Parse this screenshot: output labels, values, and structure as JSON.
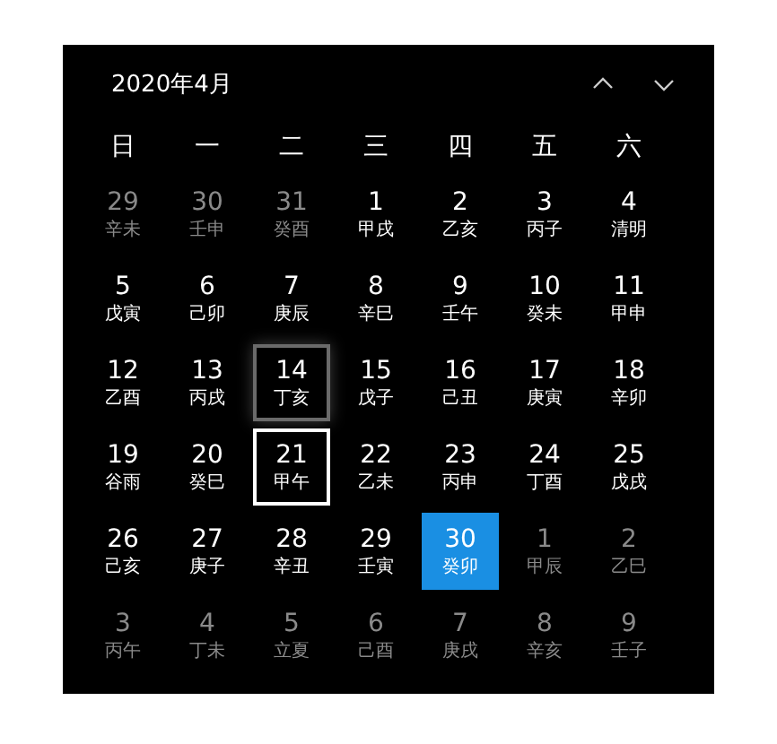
{
  "calendar": {
    "title": "2020年4月",
    "nav": [
      {
        "kind": "previous"
      },
      {
        "kind": "next"
      }
    ],
    "weekdays": [
      "日",
      "一",
      "二",
      "三",
      "四",
      "五",
      "六"
    ],
    "days": [
      {
        "day": "29",
        "lunar": "辛未",
        "in_month": false,
        "today": false,
        "selected": false,
        "hovered": false
      },
      {
        "day": "30",
        "lunar": "壬申",
        "in_month": false,
        "today": false,
        "selected": false,
        "hovered": false
      },
      {
        "day": "31",
        "lunar": "癸酉",
        "in_month": false,
        "today": false,
        "selected": false,
        "hovered": false
      },
      {
        "day": "1",
        "lunar": "甲戌",
        "in_month": true,
        "today": false,
        "selected": false,
        "hovered": false
      },
      {
        "day": "2",
        "lunar": "乙亥",
        "in_month": true,
        "today": false,
        "selected": false,
        "hovered": false
      },
      {
        "day": "3",
        "lunar": "丙子",
        "in_month": true,
        "today": false,
        "selected": false,
        "hovered": false
      },
      {
        "day": "4",
        "lunar": "清明",
        "in_month": true,
        "today": false,
        "selected": false,
        "hovered": false
      },
      {
        "day": "5",
        "lunar": "戊寅",
        "in_month": true,
        "today": false,
        "selected": false,
        "hovered": false
      },
      {
        "day": "6",
        "lunar": "己卯",
        "in_month": true,
        "today": false,
        "selected": false,
        "hovered": false
      },
      {
        "day": "7",
        "lunar": "庚辰",
        "in_month": true,
        "today": false,
        "selected": false,
        "hovered": false
      },
      {
        "day": "8",
        "lunar": "辛巳",
        "in_month": true,
        "today": false,
        "selected": false,
        "hovered": false
      },
      {
        "day": "9",
        "lunar": "壬午",
        "in_month": true,
        "today": false,
        "selected": false,
        "hovered": false
      },
      {
        "day": "10",
        "lunar": "癸未",
        "in_month": true,
        "today": false,
        "selected": false,
        "hovered": false
      },
      {
        "day": "11",
        "lunar": "甲申",
        "in_month": true,
        "today": false,
        "selected": false,
        "hovered": false
      },
      {
        "day": "12",
        "lunar": "乙酉",
        "in_month": true,
        "today": false,
        "selected": false,
        "hovered": false
      },
      {
        "day": "13",
        "lunar": "丙戌",
        "in_month": true,
        "today": false,
        "selected": false,
        "hovered": false
      },
      {
        "day": "14",
        "lunar": "丁亥",
        "in_month": true,
        "today": false,
        "selected": false,
        "hovered": true
      },
      {
        "day": "15",
        "lunar": "戊子",
        "in_month": true,
        "today": false,
        "selected": false,
        "hovered": false
      },
      {
        "day": "16",
        "lunar": "己丑",
        "in_month": true,
        "today": false,
        "selected": false,
        "hovered": false
      },
      {
        "day": "17",
        "lunar": "庚寅",
        "in_month": true,
        "today": false,
        "selected": false,
        "hovered": false
      },
      {
        "day": "18",
        "lunar": "辛卯",
        "in_month": true,
        "today": false,
        "selected": false,
        "hovered": false
      },
      {
        "day": "19",
        "lunar": "谷雨",
        "in_month": true,
        "today": false,
        "selected": false,
        "hovered": false
      },
      {
        "day": "20",
        "lunar": "癸巳",
        "in_month": true,
        "today": false,
        "selected": false,
        "hovered": false
      },
      {
        "day": "21",
        "lunar": "甲午",
        "in_month": true,
        "today": false,
        "selected": true,
        "hovered": false
      },
      {
        "day": "22",
        "lunar": "乙未",
        "in_month": true,
        "today": false,
        "selected": false,
        "hovered": false
      },
      {
        "day": "23",
        "lunar": "丙申",
        "in_month": true,
        "today": false,
        "selected": false,
        "hovered": false
      },
      {
        "day": "24",
        "lunar": "丁酉",
        "in_month": true,
        "today": false,
        "selected": false,
        "hovered": false
      },
      {
        "day": "25",
        "lunar": "戊戌",
        "in_month": true,
        "today": false,
        "selected": false,
        "hovered": false
      },
      {
        "day": "26",
        "lunar": "己亥",
        "in_month": true,
        "today": false,
        "selected": false,
        "hovered": false
      },
      {
        "day": "27",
        "lunar": "庚子",
        "in_month": true,
        "today": false,
        "selected": false,
        "hovered": false
      },
      {
        "day": "28",
        "lunar": "辛丑",
        "in_month": true,
        "today": false,
        "selected": false,
        "hovered": false
      },
      {
        "day": "29",
        "lunar": "壬寅",
        "in_month": true,
        "today": false,
        "selected": false,
        "hovered": false
      },
      {
        "day": "30",
        "lunar": "癸卯",
        "in_month": true,
        "today": true,
        "selected": false,
        "hovered": false
      },
      {
        "day": "1",
        "lunar": "甲辰",
        "in_month": false,
        "today": false,
        "selected": false,
        "hovered": false
      },
      {
        "day": "2",
        "lunar": "乙巳",
        "in_month": false,
        "today": false,
        "selected": false,
        "hovered": false
      },
      {
        "day": "3",
        "lunar": "丙午",
        "in_month": false,
        "today": false,
        "selected": false,
        "hovered": false
      },
      {
        "day": "4",
        "lunar": "丁未",
        "in_month": false,
        "today": false,
        "selected": false,
        "hovered": false
      },
      {
        "day": "5",
        "lunar": "立夏",
        "in_month": false,
        "today": false,
        "selected": false,
        "hovered": false
      },
      {
        "day": "6",
        "lunar": "己酉",
        "in_month": false,
        "today": false,
        "selected": false,
        "hovered": false
      },
      {
        "day": "7",
        "lunar": "庚戌",
        "in_month": false,
        "today": false,
        "selected": false,
        "hovered": false
      },
      {
        "day": "8",
        "lunar": "辛亥",
        "in_month": false,
        "today": false,
        "selected": false,
        "hovered": false
      },
      {
        "day": "9",
        "lunar": "壬子",
        "in_month": false,
        "today": false,
        "selected": false,
        "hovered": false
      }
    ]
  }
}
